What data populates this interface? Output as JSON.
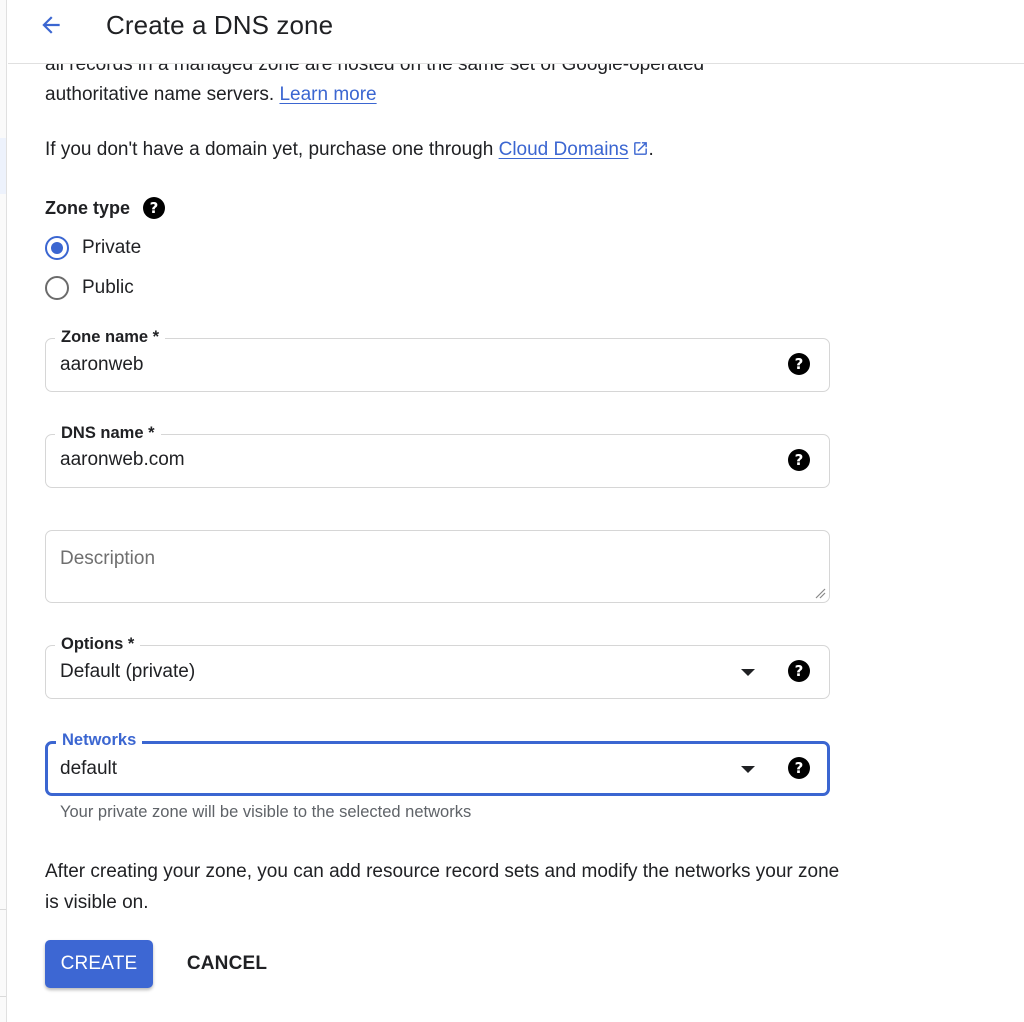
{
  "header": {
    "back_icon": "arrow-back-icon",
    "title": "Create a DNS zone"
  },
  "intro": {
    "clipped_line": "all records in a managed zone are hosted on the same set of Google-operated",
    "line2_prefix": "authoritative name servers.",
    "learn_more": "Learn more",
    "purchase_prefix": "If you don't have a domain yet, purchase one through",
    "cloud_domains": "Cloud Domains",
    "purchase_suffix": ".",
    "external_icon": "open-in-new-icon"
  },
  "zone_type": {
    "label": "Zone type",
    "help_icon": "help-icon",
    "options": [
      {
        "label": "Private",
        "checked": true
      },
      {
        "label": "Public",
        "checked": false
      }
    ]
  },
  "fields": {
    "zone_name": {
      "label": "Zone name *",
      "value": "aaronweb"
    },
    "dns_name": {
      "label": "DNS name *",
      "value": "aaronweb.com"
    },
    "description": {
      "placeholder": "Description",
      "value": ""
    },
    "options": {
      "label": "Options *",
      "value": "Default (private)"
    },
    "networks": {
      "label": "Networks",
      "value": "default",
      "hint": "Your private zone will be visible to the selected networks"
    }
  },
  "after_text": "After creating your zone, you can add resource record sets and modify the networks your zone is visible on.",
  "actions": {
    "create": "CREATE",
    "cancel": "CANCEL"
  },
  "colors": {
    "accent": "#3b66d1",
    "button": "#3d67d3",
    "text": "#202124",
    "hint": "#5f6368"
  }
}
